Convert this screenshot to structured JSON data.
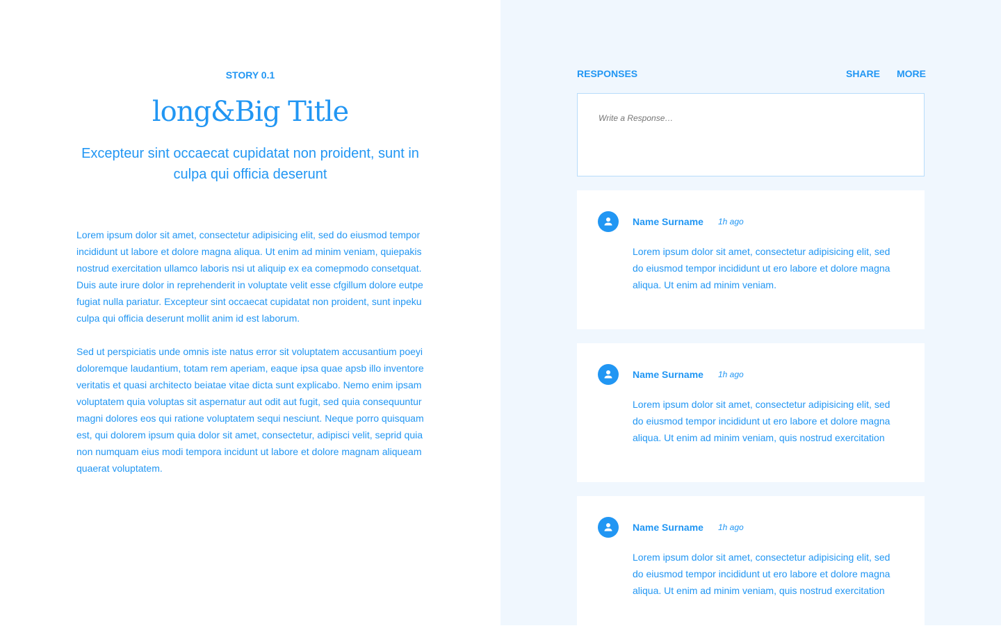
{
  "story": {
    "kicker": "STORY 0.1",
    "title": "long&Big Title",
    "subtitle": "Excepteur sint occaecat cupidatat non proident, sunt in culpa qui officia deserunt",
    "paragraphs": [
      "Lorem ipsum dolor sit amet, consectetur adipisicing elit, sed do eiusmod tempor incididunt ut labore et dolore magna aliqua. Ut enim ad minim veniam, quiepakis nostrud exercitation ullamco laboris nsi ut aliquip ex ea comepmodo consetquat. Duis aute irure dolor in reprehenderit in voluptate velit esse cfgillum dolore eutpe fugiat nulla pariatur. Excepteur sint occaecat cupidatat non proident, sunt inpeku culpa qui officia deserunt mollit anim id est laborum.",
      "Sed ut perspiciatis unde omnis iste natus error sit voluptatem accusantium poeyi doloremque laudantium, totam rem aperiam, eaque ipsa quae apsb illo inventore veritatis et quasi architecto beiatae vitae dicta sunt explicabo. Nemo enim ipsam voluptatem quia voluptas sit aspernatur aut odit aut fugit, sed quia consequuntur magni dolores eos qui ratione voluptatem sequi nesciunt. Neque porro quisquam est, qui dolorem ipsum quia dolor sit amet, consectetur, adipisci velit, seprid quia non numquam eius modi tempora incidunt ut labore et dolore magnam aliqueam quaerat voluptatem."
    ]
  },
  "responses": {
    "header": "RESPONSES",
    "share": "SHARE",
    "more": "MORE",
    "placeholder": "Write a Response…",
    "items": [
      {
        "name": "Name Surname",
        "time": "1h ago",
        "text": "Lorem ipsum dolor sit amet, consectetur adipisicing elit, sed do eiusmod tempor incididunt ut ero labore et dolore magna aliqua. Ut enim ad minim veniam."
      },
      {
        "name": "Name Surname",
        "time": "1h ago",
        "text": "Lorem ipsum dolor sit amet, consectetur adipisicing elit, sed do eiusmod tempor incididunt ut ero labore et dolore magna aliqua. Ut enim ad minim veniam, quis nostrud exercitation"
      },
      {
        "name": "Name Surname",
        "time": "1h ago",
        "text": "Lorem ipsum dolor sit amet, consectetur adipisicing elit, sed do eiusmod tempor incididunt ut ero labore et dolore magna aliqua. Ut enim ad minim veniam, quis nostrud exercitation"
      }
    ]
  },
  "colors": {
    "accent": "#2196f3",
    "panel_bg": "#f0f7fe",
    "input_border": "#b7dcfb"
  }
}
